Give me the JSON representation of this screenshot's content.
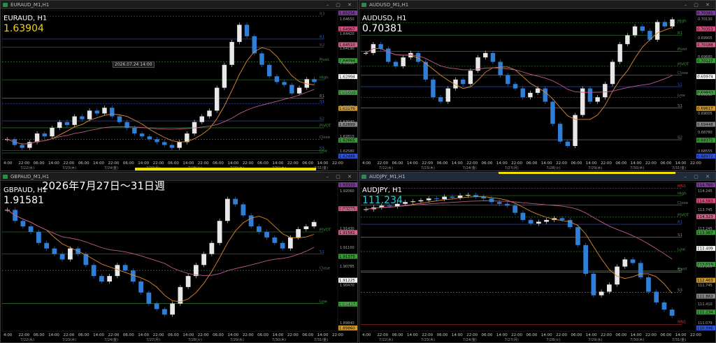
{
  "overlay_text": "2026年7月27日～31日週",
  "date_tooltip": "2026.07.24 14:00",
  "colors": {
    "up": "#e8e8e8",
    "down": "#2f7fd8",
    "ma_orange": "#e08a2a",
    "ma_pink": "#c05a8a",
    "green": "#3a9a3a",
    "blue": "#3355cc",
    "purple": "#7a3a9a"
  },
  "panels": [
    {
      "window_title": "EURAUD_M1,H1",
      "symbol": "EURAUD, H1",
      "price": "1.63904",
      "price_color": "#f0d020",
      "levels": [
        {
          "name": "R3",
          "value": 1.6505,
          "color": "#7a3a9a"
        },
        {
          "name": "R2",
          "value": 1.6451,
          "color": "#7a3a9a"
        },
        {
          "name": "R1",
          "value": 1.6465,
          "color": "#3355cc"
        },
        {
          "name": "Pivot",
          "value": 1.6425,
          "color": "#3a9a3a"
        },
        {
          "name": "High",
          "value": 1.6394,
          "color": "#3a9a3a"
        },
        {
          "name": "R1",
          "value": 1.6362,
          "color": "#888"
        },
        {
          "name": "S1",
          "value": 1.6352,
          "color": "#3355cc"
        },
        {
          "name": "S2",
          "value": 1.6322,
          "color": "#3355cc"
        },
        {
          "name": "PIVOT",
          "value": 1.631,
          "color": "#3a9a3a"
        },
        {
          "name": "Close",
          "value": 1.629,
          "color": "#3a9a3a"
        },
        {
          "name": "S3",
          "value": 1.627,
          "color": "#3355cc"
        },
        {
          "name": "Low",
          "value": 1.6266,
          "color": "#3a9a3a"
        }
      ],
      "right_tags": [
        "1.65256",
        "1.64967",
        "1.64510",
        "1.64094",
        "1.63904",
        "1.63600",
        "1.63176",
        "1.62899",
        "1.62665",
        "1.62488"
      ],
      "y_ticks": [
        "1.64650",
        "1.64420",
        "1.64190",
        "1.63960",
        "1.63730",
        "1.63500",
        "1.63270",
        "1.63040",
        "1.62810",
        "1.62580"
      ],
      "x_ticks": [
        "4:00",
        "22:00",
        "06:00",
        "14:00",
        "22:00",
        "06:00",
        "14:00",
        "22:00",
        "06:00",
        "14:00",
        "22:00",
        "06:00",
        "14:00",
        "22:00",
        "06:00",
        "14:00",
        "22:00",
        "06:00",
        "14:00",
        "22:00",
        "06:00",
        "14:00",
        "22:00"
      ],
      "date_ticks": [
        "7/22(水)",
        "7/23(木)",
        "7/24(金)",
        "7/27(月)",
        "7/28(火)",
        "7/29(水)",
        "7/30(木)",
        "7/31(金)"
      ],
      "ylim": [
        1.6255,
        1.6515
      ]
    },
    {
      "window_title": "AUDUSD_M1,H1",
      "symbol": "AUDUSD, H1",
      "price": "0.70381",
      "price_color": "#ffffff",
      "levels": [
        {
          "name": "High",
          "value": 0.7034,
          "color": "#3a9a3a"
        },
        {
          "name": "R1",
          "value": 0.702,
          "color": "#3a9a3a"
        },
        {
          "name": "Pivot",
          "value": 0.7002,
          "color": "#3a9a3a"
        },
        {
          "name": "PIVOT",
          "value": 0.6985,
          "color": "#3a9a3a"
        },
        {
          "name": "Close",
          "value": 0.6975,
          "color": "#3a9a3a"
        },
        {
          "name": "S1",
          "value": 0.6962,
          "color": "#3355cc"
        },
        {
          "name": "Low",
          "value": 0.695,
          "color": "#3a9a3a"
        },
        {
          "name": "S1",
          "value": 0.6938,
          "color": "#888"
        },
        {
          "name": "S2",
          "value": 0.6902,
          "color": "#888"
        }
      ],
      "right_tags": [
        "0.70381",
        "0.70353",
        "0.70188",
        "0.70127",
        "0.69974",
        "0.69842",
        "0.69617",
        "0.69448",
        "0.69371",
        "0.68972"
      ],
      "y_ticks": [
        "0.70130",
        "0.69905",
        "0.69680",
        "0.69455",
        "0.69230",
        "0.69005",
        "0.68780",
        "0.68555"
      ],
      "x_ticks": [
        "4:00",
        "22:00",
        "06:00",
        "14:00",
        "22:00",
        "06:00",
        "14:00",
        "22:00",
        "06:00",
        "14:00",
        "22:00",
        "06:00",
        "14:00",
        "22:00",
        "06:00",
        "14:00",
        "22:00",
        "06:00",
        "14:00",
        "22:00",
        "06:00",
        "14:00",
        "22:00"
      ],
      "date_ticks": [
        "7/22(水)",
        "7/23(木)",
        "7/24(金)",
        "7/27(月)",
        "7/28(火)",
        "7/29(水)",
        "7/30(木)",
        "7/31(金)"
      ],
      "ylim": [
        0.688,
        0.7048
      ]
    },
    {
      "window_title": "GBPAUD_M1,H1",
      "symbol": "GBPAUD, H1",
      "price": "1.91581",
      "price_color": "#ffffff",
      "levels": [
        {
          "name": "R1",
          "value": 1.929,
          "color": "#3355cc"
        },
        {
          "name": "PIVOT",
          "value": 1.914,
          "color": "#3a9a3a"
        },
        {
          "name": "S1",
          "value": 1.91,
          "color": "#3355cc"
        },
        {
          "name": "Close",
          "value": 1.907,
          "color": "#3a9a3a"
        },
        {
          "name": "Low",
          "value": 1.901,
          "color": "#3a9a3a"
        },
        {
          "name": "S3",
          "value": 1.8955,
          "color": "#3355cc"
        },
        {
          "name": "S1",
          "value": 1.891,
          "color": "#888"
        }
      ],
      "right_tags": [
        "1.93333",
        "1.93225",
        "1.91581",
        "1.91375",
        "1.91225",
        "1.90437",
        "1.89860"
      ],
      "y_ticks": [
        "1.92060",
        "1.91745",
        "1.91430",
        "1.91100",
        "1.90785",
        "1.90470",
        "1.90155",
        "1.89840"
      ],
      "x_ticks": [
        "4:00",
        "22:00",
        "06:00",
        "14:00",
        "22:00",
        "06:00",
        "14:00",
        "22:00",
        "06:00",
        "14:00",
        "22:00",
        "06:00",
        "14:00",
        "22:00",
        "06:00",
        "14:00",
        "22:00",
        "06:00",
        "14:00",
        "22:00",
        "06:00",
        "14:00",
        "22:00"
      ],
      "date_ticks": [
        "7/22(水)",
        "7/23(木)",
        "7/24(金)",
        "7/27(月)",
        "7/28(火)",
        "7/29(水)",
        "7/30(木)",
        "7/31(金)"
      ],
      "ylim": [
        1.896,
        1.923
      ]
    },
    {
      "window_title": "AUDJPY_M1,H1",
      "symbol": "AUDJPY, H1",
      "price": "111.234",
      "price_color": "#30c8e0",
      "levels": [
        {
          "name": "MN1",
          "value": 114.78,
          "color": "#cc3333"
        },
        {
          "name": "High",
          "value": 114.58,
          "color": "#3a9a3a"
        },
        {
          "name": "Close",
          "value": 114.32,
          "color": "#3a9a3a"
        },
        {
          "name": "PIVOT",
          "value": 113.98,
          "color": "#3a9a3a"
        },
        {
          "name": "R1",
          "value": 113.78,
          "color": "#3355cc"
        },
        {
          "name": "S1",
          "value": 113.42,
          "color": "#888"
        },
        {
          "name": "Low",
          "value": 113.02,
          "color": "#3a9a3a"
        },
        {
          "name": "Pivot",
          "value": 112.48,
          "color": "#3a9a3a"
        },
        {
          "name": "S2",
          "value": 112.45,
          "color": "#888"
        },
        {
          "name": "S3",
          "value": 111.88,
          "color": "#888"
        },
        {
          "name": "MN1",
          "value": 110.99,
          "color": "#cc3333"
        }
      ],
      "right_tags": [
        "114.760",
        "114.583",
        "114.323",
        "113.967",
        "113.409",
        "113.019",
        "112.463",
        "111.862",
        "111.234",
        "110.996"
      ],
      "y_ticks": [
        "114.245",
        "113.745",
        "113.245",
        "112.750",
        "112.250",
        "111.745",
        "111.410",
        "111.079"
      ],
      "x_ticks": [
        "4:00",
        "22:00",
        "06:00",
        "14:00",
        "22:00",
        "06:00",
        "14:00",
        "22:00",
        "06:00",
        "14:00",
        "22:00",
        "06:00",
        "14:00",
        "22:00",
        "06:00",
        "14:00",
        "22:00",
        "06:00",
        "14:00",
        "22:00",
        "06:00",
        "14:00",
        "22:00"
      ],
      "date_ticks": [
        "7/22(水)",
        "7/23(木)",
        "7/24(金)",
        "7/27(月)",
        "7/28(火)",
        "7/29(水)",
        "7/30(木)",
        "7/31(金)"
      ],
      "ylim": [
        110.8,
        114.95
      ]
    }
  ],
  "chart_data": [
    {
      "type": "candlestick",
      "title": "EURAUD, H1",
      "ylim": [
        1.6255,
        1.6515
      ],
      "close": [
        1.629,
        1.628,
        1.6275,
        1.6285,
        1.63,
        1.6295,
        1.631,
        1.632,
        1.6315,
        1.633,
        1.6325,
        1.634,
        1.6335,
        1.6345,
        1.633,
        1.632,
        1.631,
        1.63,
        1.6295,
        1.629,
        1.6285,
        1.628,
        1.6275,
        1.6285,
        1.63,
        1.632,
        1.633,
        1.634,
        1.638,
        1.642,
        1.646,
        1.649,
        1.647,
        1.644,
        1.642,
        1.64,
        1.639,
        1.6385,
        1.637,
        1.638,
        1.6395,
        1.639
      ]
    },
    {
      "type": "candlestick",
      "title": "AUDUSD, H1",
      "ylim": [
        0.688,
        0.7048
      ],
      "close": [
        0.7,
        0.701,
        0.7005,
        0.699,
        0.6985,
        0.6995,
        0.7,
        0.699,
        0.697,
        0.695,
        0.6945,
        0.696,
        0.697,
        0.6965,
        0.698,
        0.6995,
        0.7,
        0.699,
        0.6975,
        0.6965,
        0.696,
        0.695,
        0.6955,
        0.696,
        0.6945,
        0.692,
        0.69,
        0.6895,
        0.693,
        0.696,
        0.6945,
        0.695,
        0.6965,
        0.699,
        0.701,
        0.702,
        0.703,
        0.7025,
        0.7015,
        0.7035,
        0.703,
        0.7038
      ]
    },
    {
      "type": "candlestick",
      "title": "GBPAUD, H1",
      "ylim": [
        1.896,
        1.923
      ],
      "close": [
        1.918,
        1.916,
        1.915,
        1.914,
        1.912,
        1.911,
        1.91,
        1.909,
        1.911,
        1.91,
        1.908,
        1.906,
        1.905,
        1.906,
        1.908,
        1.907,
        1.905,
        1.903,
        1.901,
        1.9,
        1.899,
        1.901,
        1.904,
        1.906,
        1.908,
        1.91,
        1.912,
        1.916,
        1.92,
        1.919,
        1.917,
        1.915,
        1.914,
        1.913,
        1.912,
        1.911,
        1.913,
        1.9145,
        1.915,
        1.9158
      ]
    },
    {
      "type": "candlestick",
      "title": "AUDJPY, H1",
      "ylim": [
        110.8,
        114.95
      ],
      "close": [
        114.2,
        114.25,
        114.3,
        114.28,
        114.35,
        114.4,
        114.42,
        114.45,
        114.5,
        114.48,
        114.55,
        114.52,
        114.58,
        114.6,
        114.55,
        114.5,
        114.4,
        114.35,
        114.3,
        114.1,
        113.9,
        113.8,
        113.85,
        113.9,
        113.95,
        113.9,
        113.7,
        113.2,
        112.4,
        111.8,
        111.9,
        112.1,
        112.6,
        112.8,
        112.7,
        112.3,
        111.9,
        111.6,
        111.4,
        111.23
      ]
    }
  ]
}
